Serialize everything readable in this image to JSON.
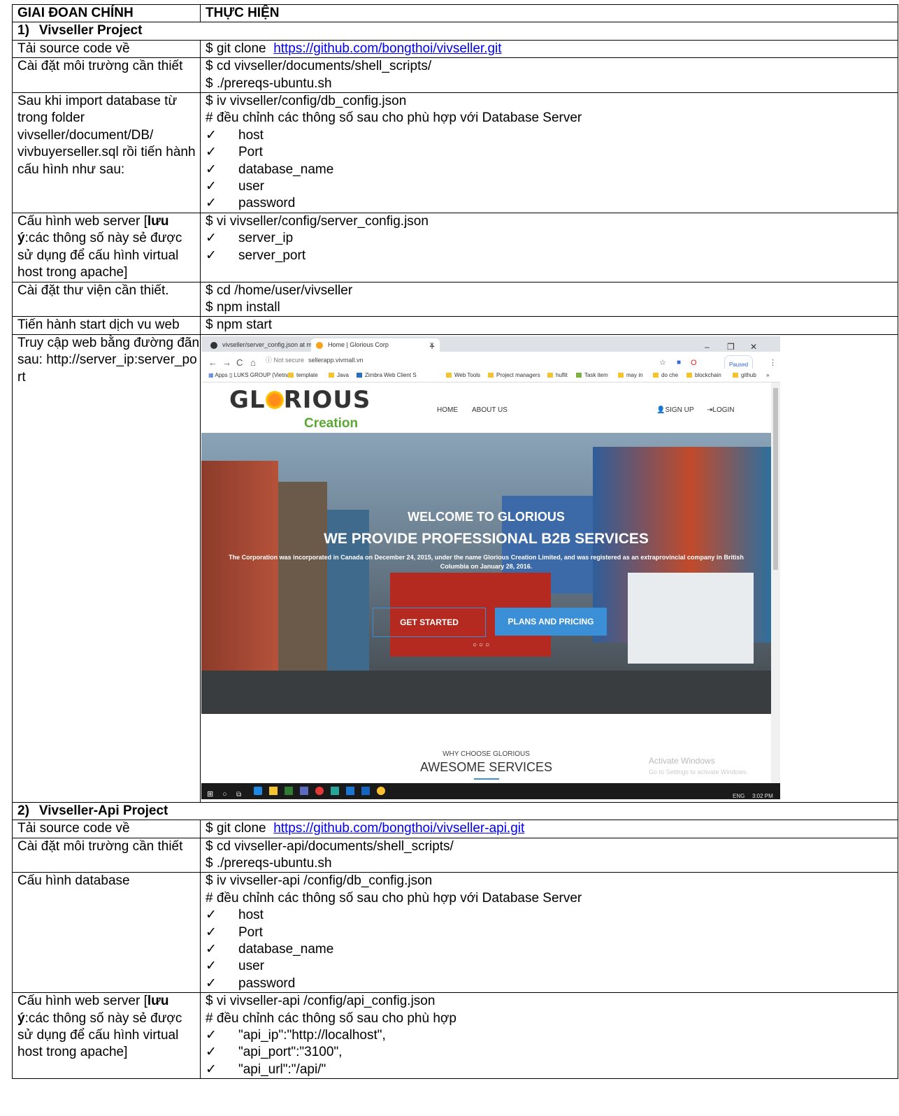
{
  "header": {
    "col1": "GIAI ĐOAN CHÍNH",
    "col2": "THỰC HIỆN"
  },
  "section1": {
    "number": "1)",
    "title": "Vivseller Project",
    "rows": [
      {
        "label": "Tải source code về",
        "cmd": "$ git clone",
        "link": "https://github.com/bongthoi/vivseller.git"
      },
      {
        "label": "Cài đặt môi trường cần thiết",
        "lines": [
          "$ cd  vivseller/documents/shell_scripts/",
          "$ ./prereqs-ubuntu.sh"
        ]
      },
      {
        "label": "Sau khi import database từ trong folder vivseller/document/DB/ vivbuyerseller.sql  rồi tiến hành cấu hình như sau:",
        "lines": [
          "$ iv  vivseller/config/db_config.json",
          "# đều chỉnh các thông số sau cho phù hợp với Database Server"
        ],
        "checks": [
          "host",
          "Port",
          "database_name",
          "user",
          "password"
        ]
      },
      {
        "label_pre": "Cấu hình web server [",
        "label_bold": "lưu ý",
        "label_post": ":các thông số này sẻ được sử dụng để cấu hình virtual host trong apache]",
        "lines": [
          "$ vi vivseller/config/server_config.json"
        ],
        "checks": [
          "server_ip",
          "server_port"
        ]
      },
      {
        "label": "Cài đặt thư viện cần thiết.",
        "lines": [
          "$ cd /home/user/vivseller",
          "$ npm install"
        ]
      },
      {
        "label": "Tiến hành start dịch vu web",
        "lines": [
          "$ npm start"
        ]
      },
      {
        "label": "Truy cập web bằng đường đãn sau: http://server_ip:server_port"
      }
    ]
  },
  "screenshot": {
    "tab1": "vivseller/server_config.json at m",
    "tab2": "Home | Glorious Corp",
    "address_secure": "ⓘ Not secure",
    "address_url": "sellerapp.vivmall.vn",
    "paused": "Paused",
    "bookmarks": [
      "Apps",
      "LUKS GROUP (Vietna",
      "template",
      "Java",
      "Zimbra Web Client S",
      "Web Tools",
      "Project managers",
      "huflit",
      "Task item",
      "may in",
      "do che",
      "blockchain",
      "github",
      "»"
    ],
    "nav": {
      "home": "HOME",
      "about": "ABOUT US",
      "signup": "SIGN UP",
      "login": "LOGIN"
    },
    "logo_main_a": "GL",
    "logo_main_b": "RIOUS",
    "logo_sub": "Creation",
    "hero_welcome": "WELCOME TO GLORIOUS",
    "hero_title": "WE PROVIDE PROFESSIONAL B2B SERVICES",
    "hero_text": "The Corporation was incorporated in Canada on December 24, 2015, under the name Glorious Creation Limited, and was registered as an extraprovincial company in British Columbia on January 28, 2016.",
    "btn_start": "GET STARTED",
    "btn_plans": "PLANS AND PRICING",
    "why": "WHY CHOOSE GLORIOUS",
    "awesome": "AWESOME SERVICES",
    "activate1": "Activate Windows",
    "activate2": "Go to Settings to activate Windows.",
    "tray_lang": "ENG",
    "tray_time": "3:02 PM",
    "colors": {
      "accent": "#3a8fd6",
      "logo_green": "#5aa832",
      "taskbar": "#1a1a1a"
    }
  },
  "section2": {
    "number": "2)",
    "title": "Vivseller-Api  Project",
    "rows": [
      {
        "label": "Tải source code về",
        "cmd": "$ git clone",
        "link": "https://github.com/bongthoi/vivseller-api.git"
      },
      {
        "label": "Cài đặt môi trường cần thiết",
        "lines": [
          "$ cd  vivseller-api/documents/shell_scripts/",
          "$ ./prereqs-ubuntu.sh"
        ]
      },
      {
        "label": "Cấu hình database",
        "lines": [
          "$ iv  vivseller-api /config/db_config.json",
          "# đều chỉnh các thông số sau cho phù hợp với Database Server"
        ],
        "checks": [
          "host",
          "Port",
          "database_name",
          "user",
          "password"
        ]
      },
      {
        "label_pre": "Cấu hình web server [",
        "label_bold": "lưu ý",
        "label_post": ":các thông số này sẻ được sử dụng để cấu hình virtual host trong apache]",
        "lines": [
          "$ vi vivseller-api /config/api_config.json",
          "# đều chỉnh các thông số sau cho phù hợp"
        ],
        "checks": [
          "\"api_ip\":\"http://localhost\",",
          "\"api_port\":\"3100\",",
          "\"api_url\":\"/api/\""
        ]
      }
    ]
  },
  "check_glyph": "✓"
}
